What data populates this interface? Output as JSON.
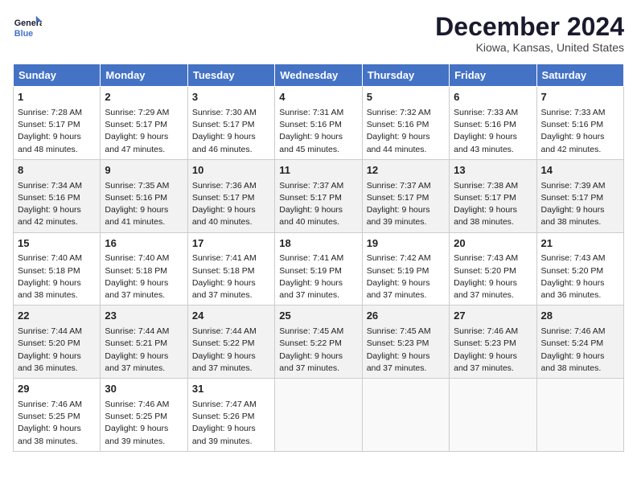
{
  "header": {
    "logo_line1": "General",
    "logo_line2": "Blue",
    "month_title": "December 2024",
    "location": "Kiowa, Kansas, United States"
  },
  "days_of_week": [
    "Sunday",
    "Monday",
    "Tuesday",
    "Wednesday",
    "Thursday",
    "Friday",
    "Saturday"
  ],
  "weeks": [
    [
      {
        "day": "1",
        "info": "Sunrise: 7:28 AM\nSunset: 5:17 PM\nDaylight: 9 hours and 48 minutes."
      },
      {
        "day": "2",
        "info": "Sunrise: 7:29 AM\nSunset: 5:17 PM\nDaylight: 9 hours and 47 minutes."
      },
      {
        "day": "3",
        "info": "Sunrise: 7:30 AM\nSunset: 5:17 PM\nDaylight: 9 hours and 46 minutes."
      },
      {
        "day": "4",
        "info": "Sunrise: 7:31 AM\nSunset: 5:16 PM\nDaylight: 9 hours and 45 minutes."
      },
      {
        "day": "5",
        "info": "Sunrise: 7:32 AM\nSunset: 5:16 PM\nDaylight: 9 hours and 44 minutes."
      },
      {
        "day": "6",
        "info": "Sunrise: 7:33 AM\nSunset: 5:16 PM\nDaylight: 9 hours and 43 minutes."
      },
      {
        "day": "7",
        "info": "Sunrise: 7:33 AM\nSunset: 5:16 PM\nDaylight: 9 hours and 42 minutes."
      }
    ],
    [
      {
        "day": "8",
        "info": "Sunrise: 7:34 AM\nSunset: 5:16 PM\nDaylight: 9 hours and 42 minutes."
      },
      {
        "day": "9",
        "info": "Sunrise: 7:35 AM\nSunset: 5:16 PM\nDaylight: 9 hours and 41 minutes."
      },
      {
        "day": "10",
        "info": "Sunrise: 7:36 AM\nSunset: 5:17 PM\nDaylight: 9 hours and 40 minutes."
      },
      {
        "day": "11",
        "info": "Sunrise: 7:37 AM\nSunset: 5:17 PM\nDaylight: 9 hours and 40 minutes."
      },
      {
        "day": "12",
        "info": "Sunrise: 7:37 AM\nSunset: 5:17 PM\nDaylight: 9 hours and 39 minutes."
      },
      {
        "day": "13",
        "info": "Sunrise: 7:38 AM\nSunset: 5:17 PM\nDaylight: 9 hours and 38 minutes."
      },
      {
        "day": "14",
        "info": "Sunrise: 7:39 AM\nSunset: 5:17 PM\nDaylight: 9 hours and 38 minutes."
      }
    ],
    [
      {
        "day": "15",
        "info": "Sunrise: 7:40 AM\nSunset: 5:18 PM\nDaylight: 9 hours and 38 minutes."
      },
      {
        "day": "16",
        "info": "Sunrise: 7:40 AM\nSunset: 5:18 PM\nDaylight: 9 hours and 37 minutes."
      },
      {
        "day": "17",
        "info": "Sunrise: 7:41 AM\nSunset: 5:18 PM\nDaylight: 9 hours and 37 minutes."
      },
      {
        "day": "18",
        "info": "Sunrise: 7:41 AM\nSunset: 5:19 PM\nDaylight: 9 hours and 37 minutes."
      },
      {
        "day": "19",
        "info": "Sunrise: 7:42 AM\nSunset: 5:19 PM\nDaylight: 9 hours and 37 minutes."
      },
      {
        "day": "20",
        "info": "Sunrise: 7:43 AM\nSunset: 5:20 PM\nDaylight: 9 hours and 37 minutes."
      },
      {
        "day": "21",
        "info": "Sunrise: 7:43 AM\nSunset: 5:20 PM\nDaylight: 9 hours and 36 minutes."
      }
    ],
    [
      {
        "day": "22",
        "info": "Sunrise: 7:44 AM\nSunset: 5:20 PM\nDaylight: 9 hours and 36 minutes."
      },
      {
        "day": "23",
        "info": "Sunrise: 7:44 AM\nSunset: 5:21 PM\nDaylight: 9 hours and 37 minutes."
      },
      {
        "day": "24",
        "info": "Sunrise: 7:44 AM\nSunset: 5:22 PM\nDaylight: 9 hours and 37 minutes."
      },
      {
        "day": "25",
        "info": "Sunrise: 7:45 AM\nSunset: 5:22 PM\nDaylight: 9 hours and 37 minutes."
      },
      {
        "day": "26",
        "info": "Sunrise: 7:45 AM\nSunset: 5:23 PM\nDaylight: 9 hours and 37 minutes."
      },
      {
        "day": "27",
        "info": "Sunrise: 7:46 AM\nSunset: 5:23 PM\nDaylight: 9 hours and 37 minutes."
      },
      {
        "day": "28",
        "info": "Sunrise: 7:46 AM\nSunset: 5:24 PM\nDaylight: 9 hours and 38 minutes."
      }
    ],
    [
      {
        "day": "29",
        "info": "Sunrise: 7:46 AM\nSunset: 5:25 PM\nDaylight: 9 hours and 38 minutes."
      },
      {
        "day": "30",
        "info": "Sunrise: 7:46 AM\nSunset: 5:25 PM\nDaylight: 9 hours and 39 minutes."
      },
      {
        "day": "31",
        "info": "Sunrise: 7:47 AM\nSunset: 5:26 PM\nDaylight: 9 hours and 39 minutes."
      },
      {
        "day": "",
        "info": ""
      },
      {
        "day": "",
        "info": ""
      },
      {
        "day": "",
        "info": ""
      },
      {
        "day": "",
        "info": ""
      }
    ]
  ]
}
